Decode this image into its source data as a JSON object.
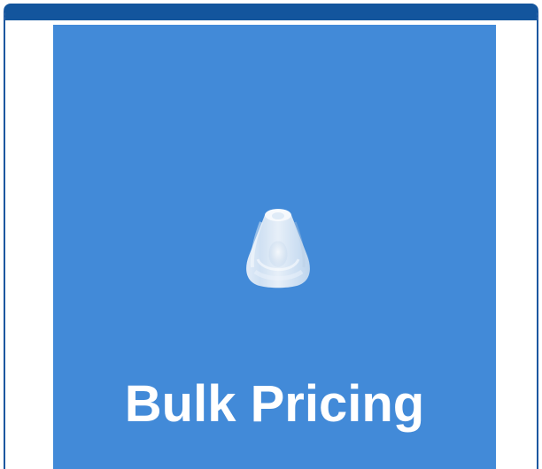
{
  "promo": {
    "label": "Bulk Pricing",
    "background_color": "#428AD8",
    "text_color": "#FFFFFF"
  },
  "frame": {
    "accent_color": "#13559D"
  },
  "product": {
    "image": "translucent-silicone-cone-tip"
  }
}
